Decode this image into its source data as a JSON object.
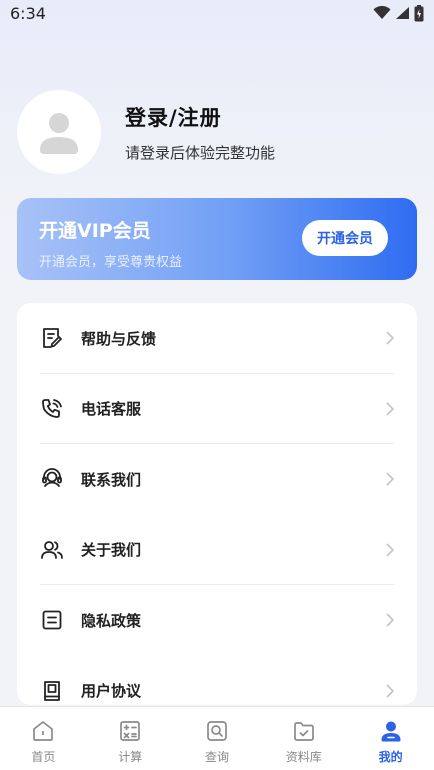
{
  "status_bar": {
    "time": "6:34"
  },
  "profile": {
    "title": "登录/注册",
    "subtitle": "请登录后体验完整功能"
  },
  "vip": {
    "title": "开通VIP会员",
    "subtitle": "开通会员，享受尊贵权益",
    "button_label": "开通会员"
  },
  "menu": {
    "items": [
      {
        "label": "帮助与反馈",
        "icon": "feedback-icon"
      },
      {
        "label": "电话客服",
        "icon": "phone-icon"
      },
      {
        "label": "联系我们",
        "icon": "headset-icon"
      },
      {
        "label": "关于我们",
        "icon": "people-icon"
      },
      {
        "label": "隐私政策",
        "icon": "document-icon"
      },
      {
        "label": "用户协议",
        "icon": "agreement-icon"
      }
    ]
  },
  "tabs": [
    {
      "label": "首页",
      "icon": "home-icon",
      "active": false
    },
    {
      "label": "计算",
      "icon": "calculator-icon",
      "active": false
    },
    {
      "label": "查询",
      "icon": "search-icon",
      "active": false
    },
    {
      "label": "资料库",
      "icon": "folder-icon",
      "active": false
    },
    {
      "label": "我的",
      "icon": "profile-icon",
      "active": true
    }
  ],
  "colors": {
    "accent": "#2a62e8",
    "vip_start": "#a8c2f7",
    "vip_end": "#2e6cf2"
  }
}
